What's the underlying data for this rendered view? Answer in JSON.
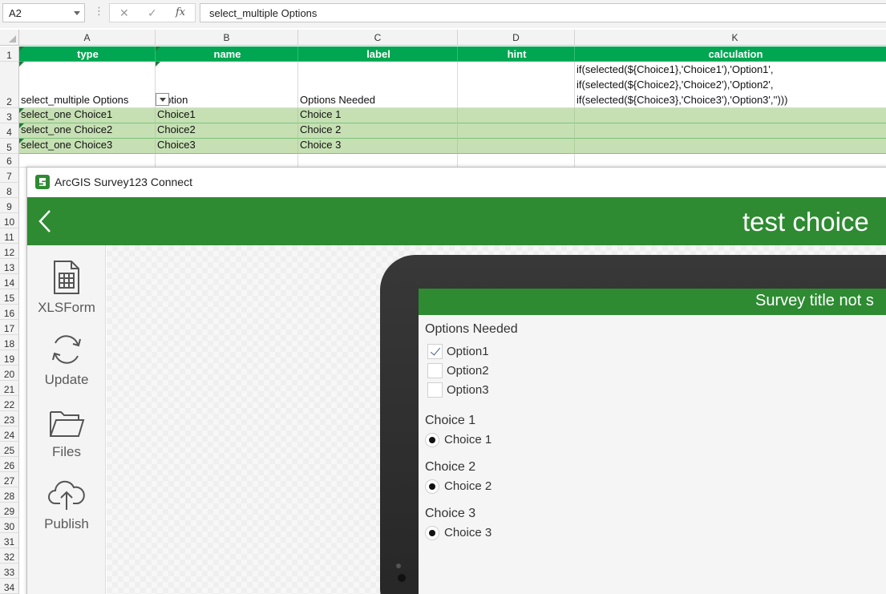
{
  "formula_bar": {
    "name_box": "A2",
    "dots": "⋮",
    "cancel_icon": "✕",
    "enter_icon": "✓",
    "fx_label": "fx",
    "formula": "select_multiple Options"
  },
  "columns": [
    "A",
    "B",
    "C",
    "D",
    "K"
  ],
  "rows": [
    "1",
    "2",
    "3",
    "4",
    "5",
    "6",
    "7",
    "8",
    "9",
    "10",
    "11",
    "12",
    "13",
    "14",
    "15",
    "16",
    "17",
    "18",
    "19",
    "20",
    "21",
    "22",
    "23",
    "24",
    "25",
    "26",
    "27",
    "28",
    "29",
    "30",
    "31",
    "32",
    "33",
    "34"
  ],
  "headers": {
    "type": "type",
    "name": "name",
    "label": "label",
    "hint": "hint",
    "calculation": "calculation"
  },
  "row2": {
    "type": "select_multiple Options",
    "name": "Option",
    "label": "Options Needed",
    "calculation": "if(selected(${Choice1},'Choice1'),'Option1',\nif(selected(${Choice2},'Choice2'),'Option2',\nif(selected(${Choice3},'Choice3'),'Option3','')))"
  },
  "data_rows": [
    {
      "type": "select_one Choice1",
      "name": "Choice1",
      "label": "Choice 1"
    },
    {
      "type": "select_one Choice2",
      "name": "Choice2",
      "label": "Choice 2"
    },
    {
      "type": "select_one Choice3",
      "name": "Choice3",
      "label": "Choice 3"
    }
  ],
  "survey123": {
    "window_title": "ArcGIS Survey123 Connect",
    "project_title": "test choice",
    "sidebar": [
      {
        "label": "XLSForm",
        "icon": "spreadsheet-icon"
      },
      {
        "label": "Update",
        "icon": "refresh-icon"
      },
      {
        "label": "Files",
        "icon": "folder-icon"
      },
      {
        "label": "Publish",
        "icon": "cloud-upload-icon"
      }
    ],
    "preview": {
      "survey_title": "Survey title not s",
      "multi_question": {
        "label": "Options Needed",
        "options": [
          {
            "label": "Option1",
            "checked": true
          },
          {
            "label": "Option2",
            "checked": false
          },
          {
            "label": "Option3",
            "checked": false
          }
        ]
      },
      "single_questions": [
        {
          "label": "Choice 1",
          "option": "Choice 1"
        },
        {
          "label": "Choice 2",
          "option": "Choice 2"
        },
        {
          "label": "Choice 3",
          "option": "Choice 3"
        }
      ]
    }
  },
  "colors": {
    "excel_header": "#00a651",
    "excel_row_fill": "#c6e0b4",
    "survey_green": "#2e8b32"
  }
}
